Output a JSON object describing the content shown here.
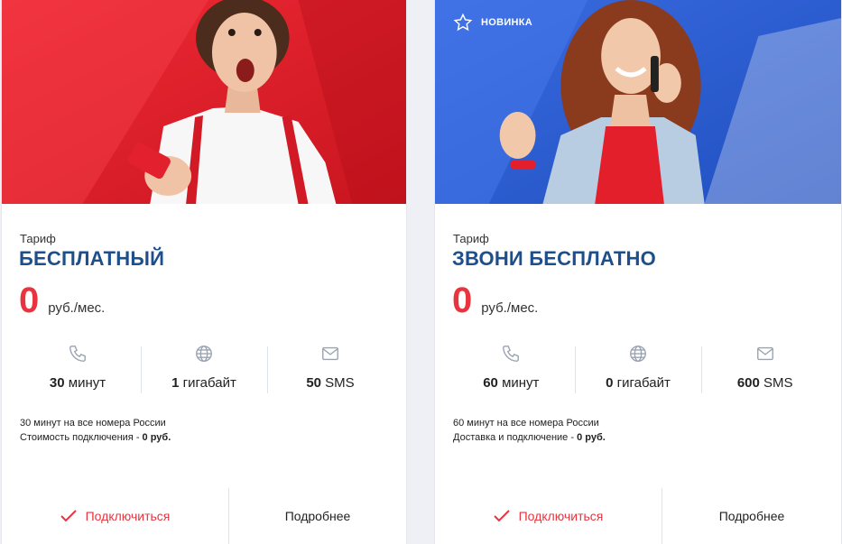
{
  "cards": [
    {
      "badge": "",
      "label": "Тариф",
      "name": "БЕСПЛАТНЫЙ",
      "price": "0",
      "price_unit": "руб./мес.",
      "features": [
        {
          "icon": "phone-icon",
          "value": "30",
          "unit": "минут"
        },
        {
          "icon": "globe-icon",
          "value": "1",
          "unit": "гигабайт"
        },
        {
          "icon": "envelope-icon",
          "value": "50",
          "unit": "SMS"
        }
      ],
      "desc_line1": "30 минут на все номера России",
      "desc_line2_text": "Стоимость подключения - ",
      "desc_line2_bold": "0 руб.",
      "connect_label": "Подключиться",
      "more_label": "Подробнее"
    },
    {
      "badge": "НОВИНКА",
      "label": "Тариф",
      "name": "ЗВОНИ БЕСПЛАТНО",
      "price": "0",
      "price_unit": "руб./мес.",
      "features": [
        {
          "icon": "phone-icon",
          "value": "60",
          "unit": "минут"
        },
        {
          "icon": "globe-icon",
          "value": "0",
          "unit": "гигабайт"
        },
        {
          "icon": "envelope-icon",
          "value": "600",
          "unit": "SMS"
        }
      ],
      "desc_line1": "60 минут на все номера России",
      "desc_line2_text": "Доставка и подключение - ",
      "desc_line2_bold": "0 руб.",
      "connect_label": "Подключиться",
      "more_label": "Подробнее"
    }
  ],
  "colors": {
    "accent_red": "#e8343f",
    "title_blue": "#1c4f8c",
    "hero_red": "#e4232f",
    "hero_blue": "#2f5fd0"
  }
}
